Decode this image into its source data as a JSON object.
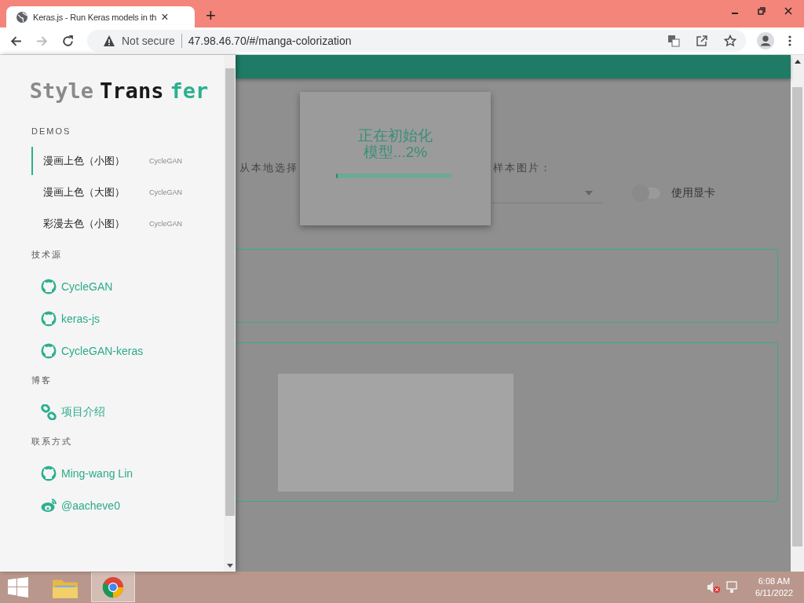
{
  "browser": {
    "tab_title": "Keras.js - Run Keras models in th",
    "tab_close": "×",
    "new_tab": "+",
    "security": "Not secure",
    "url": "47.98.46.70/#/manga-colorization"
  },
  "sidebar": {
    "logo": [
      {
        "text": "Style",
        "color": "#8a8a8a"
      },
      {
        "text": "Trans",
        "color": "#1a1a1a"
      },
      {
        "text": "fer",
        "color": "#2bb08f"
      }
    ],
    "sections": [
      {
        "heading": "DEMOS",
        "items": [
          {
            "kind": "demo",
            "label": "漫画上色（小图）",
            "tag": "CycleGAN",
            "selected": true
          },
          {
            "kind": "demo",
            "label": "漫画上色（大图）",
            "tag": "CycleGAN",
            "selected": false
          },
          {
            "kind": "demo",
            "label": "彩漫去色（小图）",
            "tag": "CycleGAN",
            "selected": false
          }
        ]
      },
      {
        "heading": "技术源",
        "items": [
          {
            "kind": "github",
            "label": "CycleGAN"
          },
          {
            "kind": "github",
            "label": "keras-js"
          },
          {
            "kind": "github",
            "label": "CycleGAN-keras"
          }
        ]
      },
      {
        "heading": "博客",
        "items": [
          {
            "kind": "chain",
            "label": "项目介绍"
          }
        ]
      },
      {
        "heading": "联系方式",
        "items": [
          {
            "kind": "github",
            "label": "Ming-wang Lin"
          },
          {
            "kind": "weibo",
            "label": "@aacheve0"
          }
        ]
      }
    ]
  },
  "main": {
    "file_label": "从本地选择",
    "sample_label": "样本图片：",
    "gpu_toggle": {
      "label": "使用显卡",
      "on": false
    }
  },
  "dialog": {
    "line1": "正在初始化",
    "line2": "模型...2%",
    "level": 0.02
  },
  "taskbar": {
    "time": "6:08 AM",
    "date": "6/11/2022"
  }
}
